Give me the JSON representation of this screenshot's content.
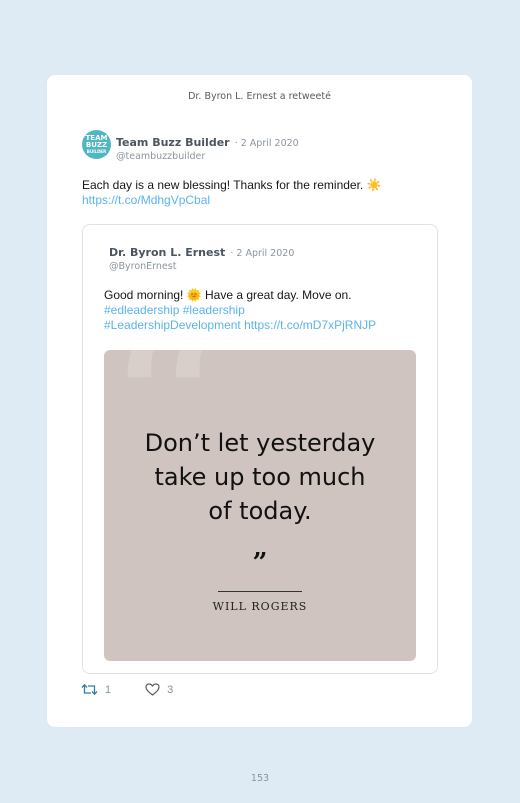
{
  "retweet_note": "Dr. Byron L. Ernest a retweeté",
  "tweet": {
    "avatar_text": [
      "TEAM",
      "BUZZ",
      "BUILDER"
    ],
    "author_name": "Team Buzz Builder",
    "date": "· 2 April 2020",
    "handle": "@teambuzzbuilder",
    "text": "Each day is a new blessing! Thanks for the reminder. ☀️",
    "link": "https://t.co/MdhgVpCbal"
  },
  "quoted_tweet": {
    "author_name": "Dr. Byron L. Ernest",
    "date": "· 2 April 2020",
    "handle": "@ByronErnest",
    "text": "Good morning! 🌞 Have a great day. Move on.",
    "hashtags_line1": "#edleadership #leadership",
    "hashtags_line2": "#LeadershipDevelopment",
    "link": "https://t.co/mD7xPjRNJP",
    "image": {
      "quote_line1": "Don’t let yesterday",
      "quote_line2": "take up too much",
      "quote_line3": "of today.",
      "closing_mark": "”",
      "quote_author": "WILL ROGERS"
    }
  },
  "actions": {
    "retweet_count": "1",
    "like_count": "3",
    "retweet_icon": "retweet-icon",
    "like_icon": "heart-icon"
  },
  "page_number": "153",
  "colors": {
    "background": "#deebf4",
    "link": "#5ab4ea",
    "image_background": "#cfc4bf"
  }
}
